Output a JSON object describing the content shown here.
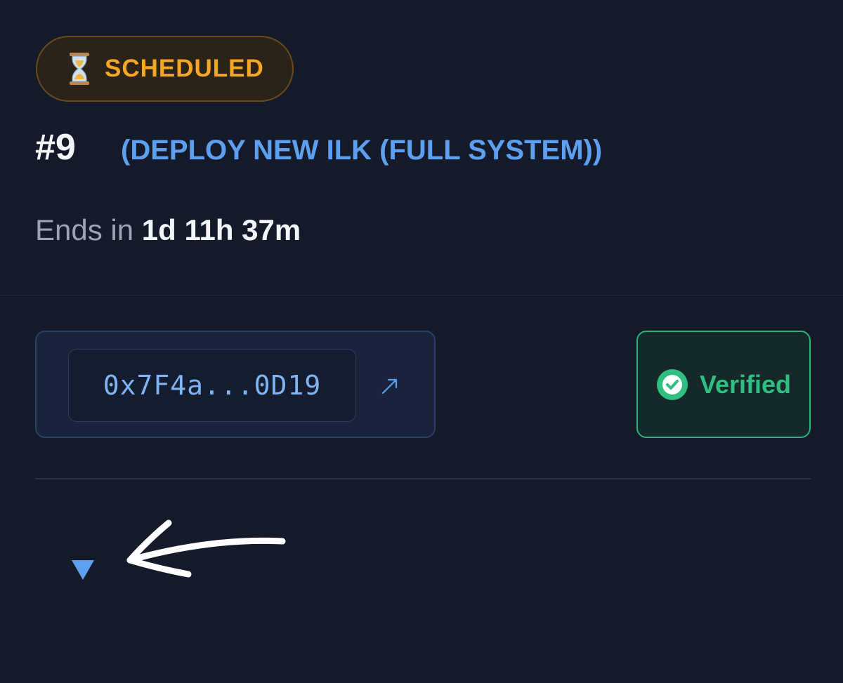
{
  "status": {
    "icon": "hourglass-icon",
    "label": "SCHEDULED",
    "color": "#f5a623"
  },
  "proposal": {
    "number": "#9",
    "title": "(DEPLOY NEW ILK (FULL SYSTEM))",
    "title_color": "#5ea0f0"
  },
  "countdown": {
    "label": "Ends in",
    "value": "1d 11h 37m"
  },
  "address": {
    "value": "0x7F4a...0D19",
    "link_icon": "external-link-icon"
  },
  "verification": {
    "icon": "check-circle-icon",
    "label": "Verified",
    "color": "#2fbf80"
  },
  "expand": {
    "icon": "chevron-down-icon",
    "color": "#5ea0f0"
  },
  "annotation": {
    "icon": "arrow-left-icon"
  }
}
